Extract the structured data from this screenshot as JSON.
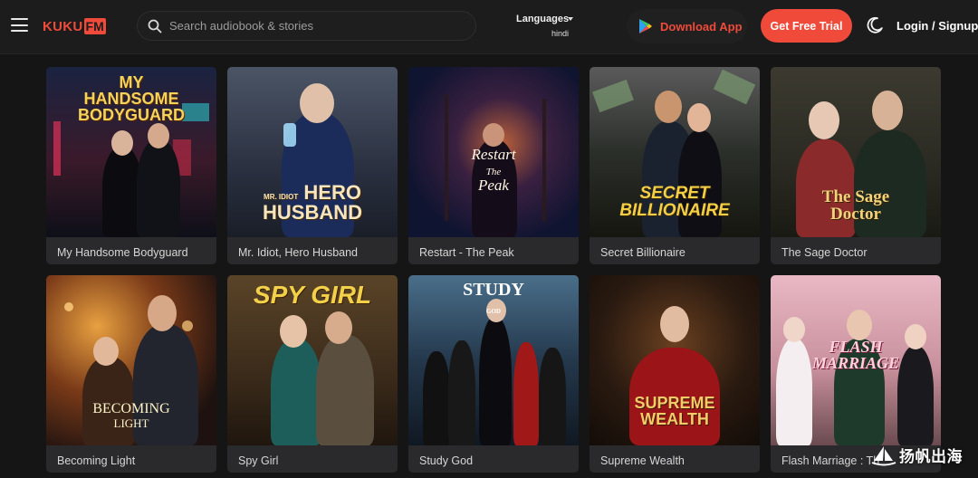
{
  "header": {
    "logo_kuku": "KUKU",
    "logo_fm": "FM",
    "search_placeholder": "Search audiobook & stories",
    "languages_label": "Languages",
    "language_value": "hindi",
    "download_label": "Download App",
    "trial_label": "Get Free Trial",
    "login_label": "Login / Signup"
  },
  "books": [
    {
      "title": "My Handsome Bodyguard",
      "cover_text": [
        "MY",
        "HANDSOME",
        "BODYGUARD"
      ]
    },
    {
      "title": "Mr. Idiot, Hero Husband",
      "cover_text": [
        "MR. IDIOT",
        "HERO",
        "HUSBAND"
      ]
    },
    {
      "title": "Restart - The Peak",
      "cover_text": [
        "Restart",
        "The",
        "Peak"
      ]
    },
    {
      "title": "Secret Billionaire",
      "cover_text": [
        "SECRET",
        "BILLIONAIRE"
      ]
    },
    {
      "title": "The Sage Doctor",
      "cover_text": [
        "The Sage",
        "Doctor"
      ]
    },
    {
      "title": "Becoming Light",
      "cover_text": [
        "BECOMING",
        "LIGHT"
      ]
    },
    {
      "title": "Spy Girl",
      "cover_text": [
        "SPY GIRL"
      ]
    },
    {
      "title": "Study God",
      "cover_text": [
        "STUDY",
        "GOD"
      ]
    },
    {
      "title": "Supreme Wealth",
      "cover_text": [
        "SUPREME",
        "WEALTH"
      ]
    },
    {
      "title": "Flash Marriage : Th",
      "cover_text": [
        "FLASH",
        "MARRIAGE"
      ]
    }
  ],
  "watermark": "扬帆出海",
  "colors": {
    "accent": "#ef4a3a",
    "background": "#151515",
    "card": "#2a2a2c"
  }
}
